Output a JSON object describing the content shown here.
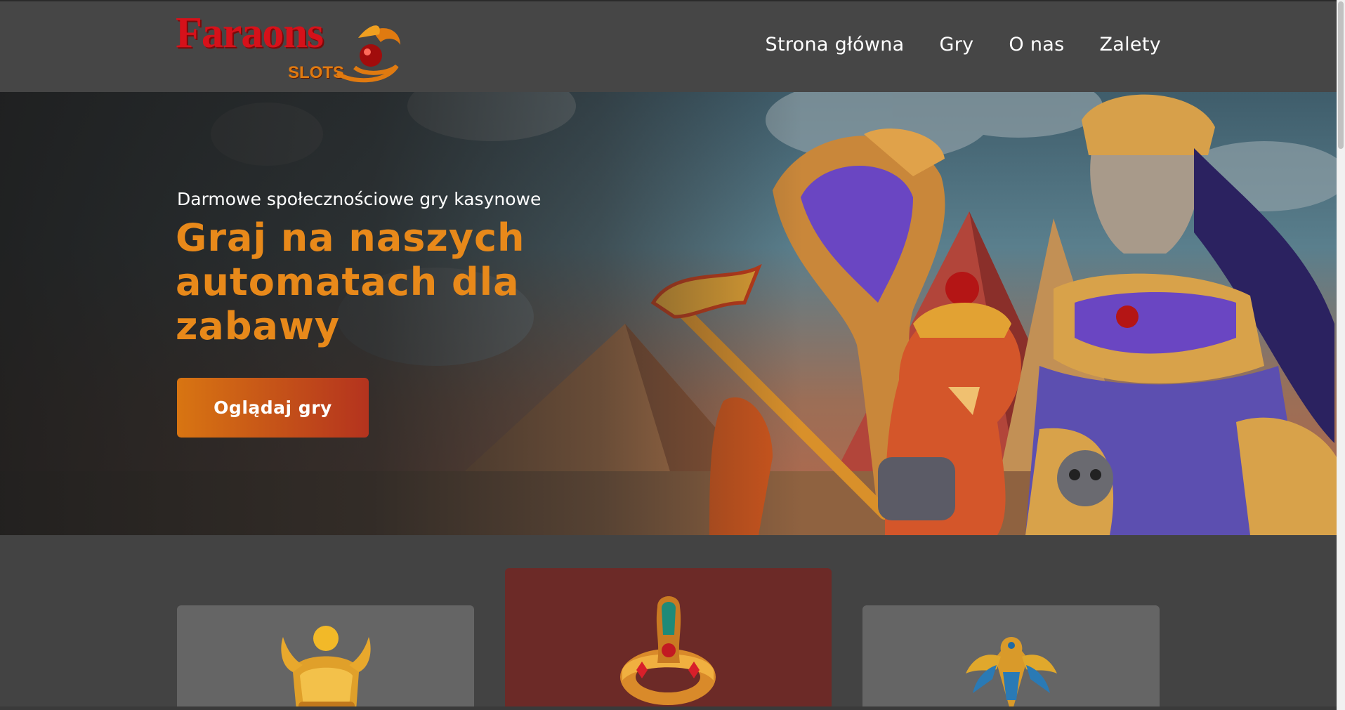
{
  "logo": {
    "main": "Faraons",
    "sub": "SLOTS"
  },
  "nav": {
    "items": [
      {
        "label": "Strona główna"
      },
      {
        "label": "Gry"
      },
      {
        "label": "O nas"
      },
      {
        "label": "Zalety"
      }
    ]
  },
  "hero": {
    "kicker": "Darmowe społecznościowe gry kasynowe",
    "title": "Graj na naszych automatach dla zabawy",
    "button_label": "Oglądaj gry"
  },
  "cards": [
    {
      "icon": "golden-helmet-icon"
    },
    {
      "icon": "cobra-crown-icon"
    },
    {
      "icon": "golden-falcon-icon"
    }
  ],
  "colors": {
    "accent": "#e8891a",
    "button_start": "#d87512",
    "button_end": "#b4331e",
    "header_bg": "#464646",
    "page_bg": "#434343",
    "highlight_card": "#6c2a27",
    "card_bg": "#656565"
  }
}
